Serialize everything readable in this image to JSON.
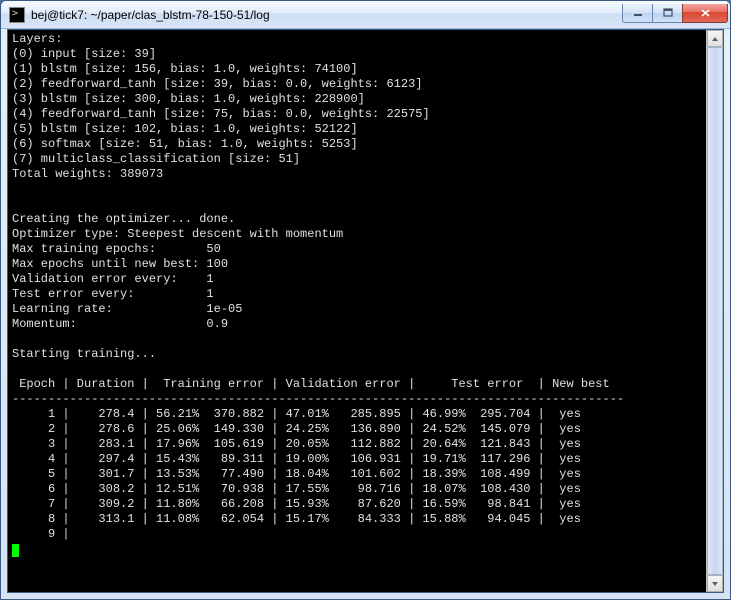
{
  "window": {
    "title": "bej@tick7: ~/paper/clas_blstm-78-150-51/log"
  },
  "terminal": {
    "layers_header": "Layers:",
    "layers": [
      "(0) input [size: 39]",
      "(1) blstm [size: 156, bias: 1.0, weights: 74100]",
      "(2) feedforward_tanh [size: 39, bias: 0.0, weights: 6123]",
      "(3) blstm [size: 300, bias: 1.0, weights: 228900]",
      "(4) feedforward_tanh [size: 75, bias: 0.0, weights: 22575]",
      "(5) blstm [size: 102, bias: 1.0, weights: 52122]",
      "(6) softmax [size: 51, bias: 1.0, weights: 5253]",
      "(7) multiclass_classification [size: 51]"
    ],
    "total_weights": "Total weights: 389073",
    "creating": "Creating the optimizer... done.",
    "optimizer": "Optimizer type: Steepest descent with momentum",
    "params": [
      {
        "label": "Max training epochs:      ",
        "value": "50"
      },
      {
        "label": "Max epochs until new best:",
        "value": "100"
      },
      {
        "label": "Validation error every:   ",
        "value": "1"
      },
      {
        "label": "Test error every:         ",
        "value": "1"
      },
      {
        "label": "Learning rate:            ",
        "value": "1e-05"
      },
      {
        "label": "Momentum:                 ",
        "value": "0.9"
      }
    ],
    "starting": "Starting training...",
    "table_header": " Epoch | Duration |  Training error | Validation error |     Test error  | New best",
    "table_divider": "-------------------------------------------------------------------------------------",
    "rows": [
      "     1 |    278.4 | 56.21%  370.882 | 47.01%   285.895 | 46.99%  295.704 |  yes",
      "     2 |    278.6 | 25.06%  149.330 | 24.25%   136.890 | 24.52%  145.079 |  yes",
      "     3 |    283.1 | 17.96%  105.619 | 20.05%   112.882 | 20.64%  121.843 |  yes",
      "     4 |    297.4 | 15.43%   89.311 | 19.00%   106.931 | 19.71%  117.296 |  yes",
      "     5 |    301.7 | 13.53%   77.490 | 18.04%   101.602 | 18.39%  108.499 |  yes",
      "     6 |    308.2 | 12.51%   70.938 | 17.55%    98.716 | 18.07%  108.430 |  yes",
      "     7 |    309.2 | 11.80%   66.208 | 15.93%    87.620 | 16.59%   98.841 |  yes",
      "     8 |    313.1 | 11.08%   62.054 | 15.17%    84.333 | 15.88%   94.045 |  yes",
      "     9 |"
    ]
  },
  "chart_data": {
    "type": "table",
    "title": "Training log",
    "columns": [
      "Epoch",
      "Duration",
      "Training error %",
      "Training error val",
      "Validation error %",
      "Validation error val",
      "Test error %",
      "Test error val",
      "New best"
    ],
    "rows": [
      [
        1,
        278.4,
        56.21,
        370.882,
        47.01,
        285.895,
        46.99,
        295.704,
        "yes"
      ],
      [
        2,
        278.6,
        25.06,
        149.33,
        24.25,
        136.89,
        24.52,
        145.079,
        "yes"
      ],
      [
        3,
        283.1,
        17.96,
        105.619,
        20.05,
        112.882,
        20.64,
        121.843,
        "yes"
      ],
      [
        4,
        297.4,
        15.43,
        89.311,
        19.0,
        106.931,
        19.71,
        117.296,
        "yes"
      ],
      [
        5,
        301.7,
        13.53,
        77.49,
        18.04,
        101.602,
        18.39,
        108.499,
        "yes"
      ],
      [
        6,
        308.2,
        12.51,
        70.938,
        17.55,
        98.716,
        18.07,
        108.43,
        "yes"
      ],
      [
        7,
        309.2,
        11.8,
        66.208,
        15.93,
        87.62,
        16.59,
        98.841,
        "yes"
      ],
      [
        8,
        313.1,
        11.08,
        62.054,
        15.17,
        84.333,
        15.88,
        94.045,
        "yes"
      ]
    ]
  }
}
